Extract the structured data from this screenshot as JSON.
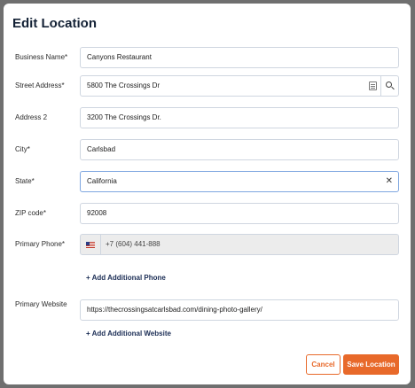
{
  "modal": {
    "title": "Edit Location"
  },
  "fields": {
    "business_name": {
      "label": "Business Name*",
      "value": "Canyons Restaurant"
    },
    "street_address": {
      "label": "Street Address*",
      "value": "5800 The Crossings Dr"
    },
    "address2": {
      "label": "Address 2",
      "value": "3200 The Crossings Dr."
    },
    "city": {
      "label": "City*",
      "value": "Carlsbad"
    },
    "state": {
      "label": "State*",
      "value": "California"
    },
    "zip": {
      "label": "ZIP code*",
      "value": "92008"
    },
    "primary_phone": {
      "label": "Primary Phone*",
      "value": "+7 (604) 441-888"
    },
    "primary_website": {
      "label": "Primary Website",
      "value": "https://thecrossingsatcarlsbad.com/dining-photo-gallery/"
    }
  },
  "links": {
    "add_phone": "+ Add Additional Phone",
    "add_website": "+ Add Additional Website"
  },
  "buttons": {
    "cancel": "Cancel",
    "save": "Save Location"
  },
  "icons": {
    "address_card": "address-card-icon",
    "search": "search-icon",
    "clear": "close-icon",
    "flag": "us-flag-icon"
  },
  "colors": {
    "accent": "#e8692a",
    "title": "#142236",
    "link": "#1b2d55",
    "focus_border": "#7ea6e0"
  }
}
